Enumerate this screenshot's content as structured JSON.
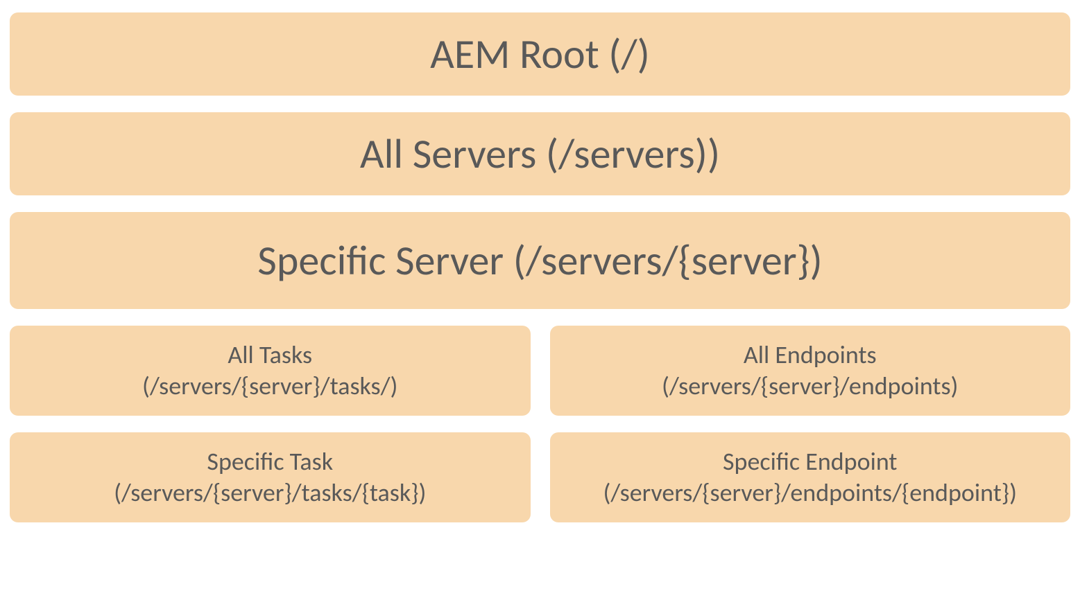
{
  "hierarchy": {
    "root": {
      "label": "AEM Root (/)"
    },
    "all_servers": {
      "label": "All Servers (/servers))"
    },
    "specific_server": {
      "label": "Specific Server (/servers/{server})"
    },
    "all_tasks": {
      "title": "All Tasks",
      "path": "(/servers/{server}/tasks/)"
    },
    "all_endpoints": {
      "title": "All Endpoints",
      "path": "(/servers/{server}/endpoints)"
    },
    "specific_task": {
      "title": "Specific Task",
      "path": "(/servers/{server}/tasks/{task})"
    },
    "specific_endpoint": {
      "title": "Specific Endpoint",
      "path": "(/servers/{server}/endpoints/{endpoint})"
    }
  },
  "colors": {
    "box_background": "#f8d7ac",
    "text": "#595959"
  }
}
